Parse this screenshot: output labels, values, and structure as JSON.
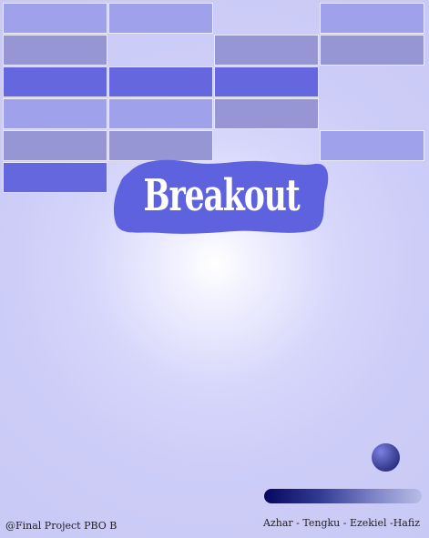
{
  "title": "Breakout",
  "footer": {
    "left_text": "@Final Project PBO B",
    "right_text": "Azhar - Tengku - Ezekiel -Hafiz"
  },
  "colors": {
    "title_blob": "#5e62de",
    "title_text": "#ffffff",
    "brick_light": "#9fa1ea",
    "brick_gray": "#9796d4",
    "brick_dark": "#6467dd",
    "paddle_start": "#07075f",
    "paddle_end": "#b8bde5",
    "ball": "#3f459c"
  },
  "bricks": [
    {
      "row": 1,
      "col": 1,
      "color": "#9fa1ea"
    },
    {
      "row": 1,
      "col": 2,
      "color": "#9fa1ea"
    },
    {
      "row": 1,
      "col": 4,
      "color": "#9fa1ea"
    },
    {
      "row": 2,
      "col": 1,
      "color": "#9796d4"
    },
    {
      "row": 2,
      "col": 3,
      "color": "#9796d4"
    },
    {
      "row": 2,
      "col": 4,
      "color": "#9796d4"
    },
    {
      "row": 3,
      "col": 1,
      "color": "#6467dd"
    },
    {
      "row": 3,
      "col": 2,
      "color": "#6467dd"
    },
    {
      "row": 3,
      "col": 3,
      "color": "#6467dd"
    },
    {
      "row": 4,
      "col": 1,
      "color": "#9fa1ea"
    },
    {
      "row": 4,
      "col": 2,
      "color": "#9fa1ea"
    },
    {
      "row": 4,
      "col": 3,
      "color": "#9796d4"
    },
    {
      "row": 5,
      "col": 1,
      "color": "#9796d4"
    },
    {
      "row": 5,
      "col": 2,
      "color": "#9796d4"
    },
    {
      "row": 5,
      "col": 4,
      "color": "#9fa1ea"
    },
    {
      "row": 6,
      "col": 1,
      "color": "#6467dd"
    }
  ]
}
